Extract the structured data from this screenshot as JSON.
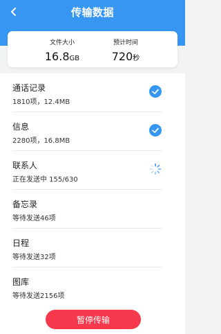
{
  "header": {
    "title": "传输数据"
  },
  "summary": {
    "size_label": "文件大小",
    "size_value": "16.8",
    "size_unit": "GB",
    "time_label": "预计时间",
    "time_value": "720",
    "time_unit": "秒"
  },
  "items": [
    {
      "title": "通话记录",
      "detail": "1810项，12.4MB",
      "status": "done"
    },
    {
      "title": "信息",
      "detail": "2280项，16.8MB",
      "status": "done"
    },
    {
      "title": "联系人",
      "detail": "正在发送中  155/630",
      "status": "sending"
    },
    {
      "title": "备忘录",
      "detail": "等待发送46项",
      "status": "waiting"
    },
    {
      "title": "日程",
      "detail": "等待发送32项",
      "status": "waiting"
    },
    {
      "title": "图库",
      "detail": "等待发送2156项",
      "status": "waiting"
    }
  ],
  "footer": {
    "pause_label": "暂停传输"
  },
  "colors": {
    "primary": "#3796f2",
    "danger": "#f5384c"
  }
}
